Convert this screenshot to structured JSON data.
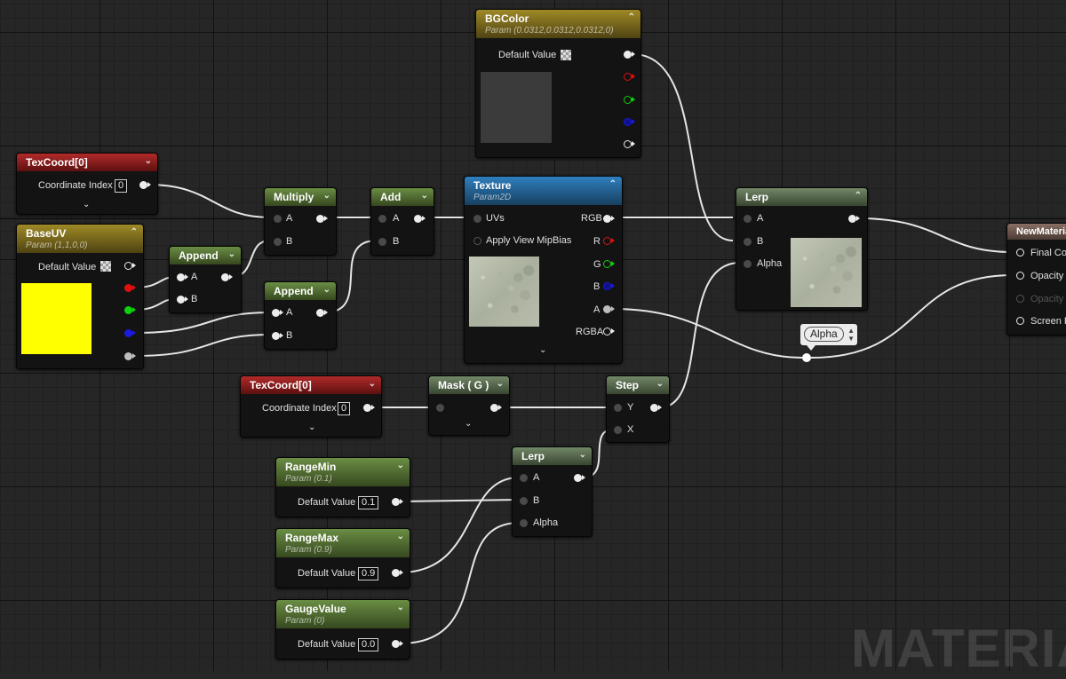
{
  "watermark": "MATERIAL",
  "nodes": {
    "bgcolor": {
      "title": "BGColor",
      "subtitle": "Param (0.0312,0.0312,0.0312,0)",
      "default_label": "Default Value",
      "swatch_color": "#3b3b3b"
    },
    "texcoord1": {
      "title": "TexCoord[0]",
      "coord_label": "Coordinate Index",
      "coord_value": "0"
    },
    "baseuv": {
      "title": "BaseUV",
      "subtitle": "Param (1,1,0,0)",
      "default_label": "Default Value",
      "swatch_color": "#ffff00"
    },
    "append1": {
      "title": "Append",
      "pin_a": "A",
      "pin_b": "B"
    },
    "append2": {
      "title": "Append",
      "pin_a": "A",
      "pin_b": "B"
    },
    "multiply": {
      "title": "Multiply",
      "pin_a": "A",
      "pin_b": "B"
    },
    "add": {
      "title": "Add",
      "pin_a": "A",
      "pin_b": "B"
    },
    "texture": {
      "title": "Texture",
      "subtitle": "Param2D",
      "uvs": "UVs",
      "mip": "Apply View MipBias",
      "rgb": "RGB",
      "r": "R",
      "g": "G",
      "b": "B",
      "a": "A",
      "rgba": "RGBA"
    },
    "lerp_top": {
      "title": "Lerp",
      "pin_a": "A",
      "pin_b": "B",
      "pin_alpha": "Alpha"
    },
    "newmaterial": {
      "title": "NewMateria",
      "final": "Final Col",
      "opacity": "Opacity",
      "opacity_mask": "Opacity",
      "screen": "Screen P"
    },
    "texcoord2": {
      "title": "TexCoord[0]",
      "coord_label": "Coordinate Index",
      "coord_value": "0"
    },
    "mask": {
      "title": "Mask ( G )"
    },
    "step": {
      "title": "Step",
      "pin_y": "Y",
      "pin_x": "X"
    },
    "lerp_bottom": {
      "title": "Lerp",
      "pin_a": "A",
      "pin_b": "B",
      "pin_alpha": "Alpha"
    },
    "rangemin": {
      "title": "RangeMin",
      "subtitle": "Param (0.1)",
      "default_label": "Default Value",
      "value": "0.1"
    },
    "rangemax": {
      "title": "RangeMax",
      "subtitle": "Param (0.9)",
      "default_label": "Default Value",
      "value": "0.9"
    },
    "gaugevalue": {
      "title": "GaugeValue",
      "subtitle": "Param (0)",
      "default_label": "Default Value",
      "value": "0.0"
    }
  },
  "reroute_comment": "Alpha",
  "icons": {
    "collapse": "chevron-up-icon",
    "dropdown": "chevron-down-icon",
    "pin": "pin-icon"
  },
  "colors": {
    "wire": "#e6e6e6",
    "param_header": "#9f8a27",
    "texcoord_header": "#b22a2a",
    "math_header": "#6a8d44",
    "texture_header": "#2f7fbe"
  }
}
